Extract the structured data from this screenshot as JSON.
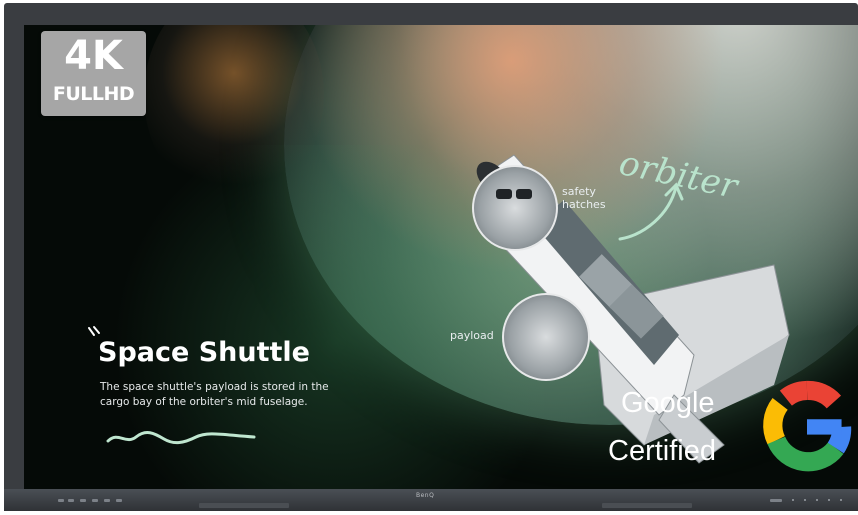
{
  "badge": {
    "top": "4K",
    "bottom": "FULLHD"
  },
  "slide": {
    "title": "Space Shuttle",
    "description": "The space shuttle's payload is stored in the cargo bay of the orbiter's mid fuselage.",
    "annotations": {
      "safety_hatches": "safety\nhatches",
      "payload": "payload",
      "orbiter": "orbiter"
    }
  },
  "overlay": {
    "line1": "Google",
    "line2": "Certified"
  },
  "bezel": {
    "brand": "BenQ"
  },
  "icons": {
    "google": "google-g-logo-icon"
  },
  "colors": {
    "frame": "#3a3d41",
    "badge": "#a6a6a6",
    "google_blue": "#4285F4",
    "google_red": "#EA4335",
    "google_yellow": "#FBBC05",
    "google_green": "#34A853",
    "annotation": "#b9e3cc"
  }
}
